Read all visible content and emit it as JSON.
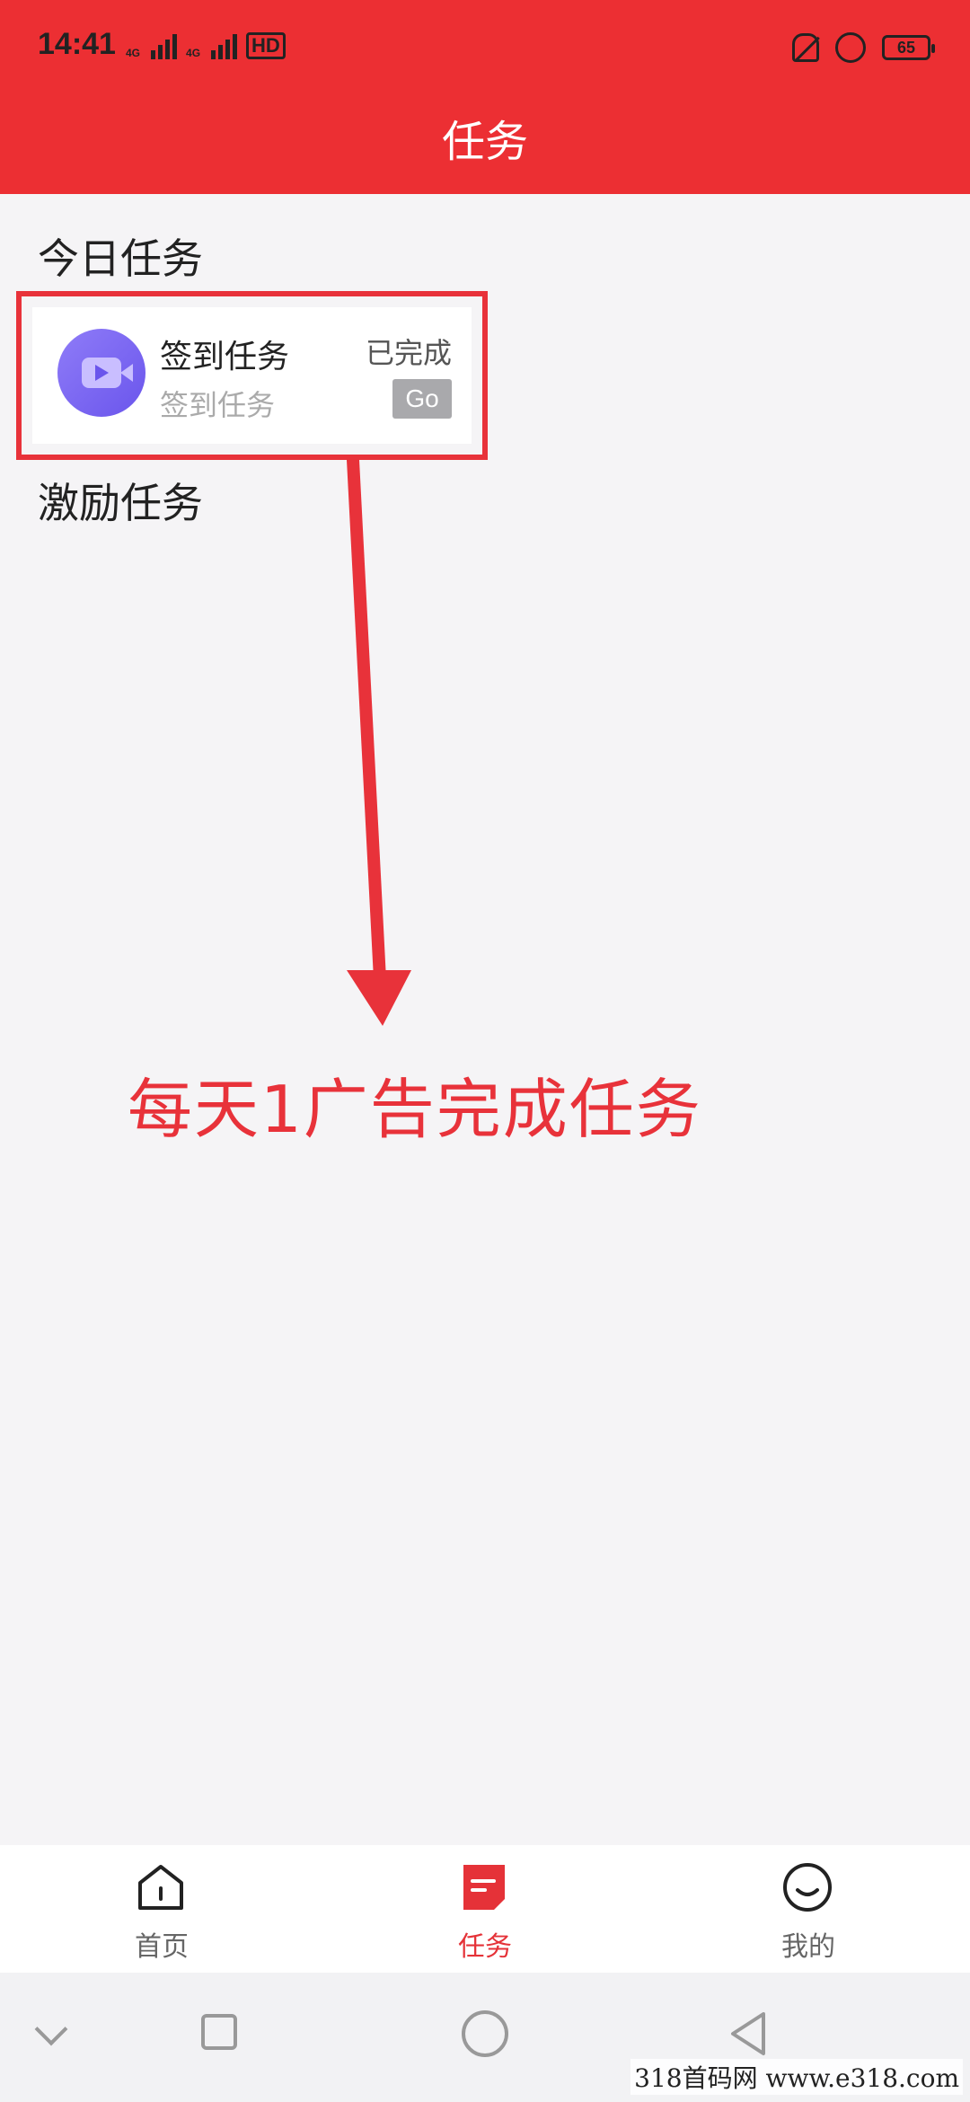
{
  "status_bar": {
    "time": "14:41",
    "network_tag": "4G",
    "hd_label": "HD",
    "battery": "65"
  },
  "header": {
    "title": "任务"
  },
  "sections": {
    "today": "今日任务",
    "incentive": "激励任务"
  },
  "task": {
    "name": "签到任务",
    "subtitle": "签到任务",
    "status": "已完成",
    "button": "Go"
  },
  "annotation": {
    "text": "每天1广告完成任务",
    "color": "#e8323a"
  },
  "tabs": [
    {
      "label": "首页",
      "icon": "home-icon"
    },
    {
      "label": "任务",
      "icon": "task-icon",
      "active": true
    },
    {
      "label": "我的",
      "icon": "smile-icon"
    }
  ],
  "system_nav": [
    "chevron-down-icon",
    "recents-icon",
    "home-circle-icon",
    "back-triangle-icon"
  ],
  "watermark": "318首码网 www.e318.com",
  "colors": {
    "brand_red": "#ec2f33",
    "background": "#f5f4f6",
    "task_icon": "#7b66f2"
  }
}
